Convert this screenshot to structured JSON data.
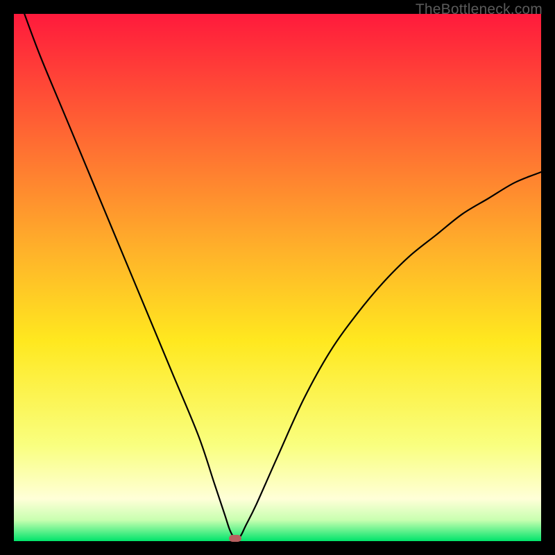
{
  "watermark": "TheBottleneck.com",
  "colors": {
    "top": "#ff1a3c",
    "upper_mid": "#ff7a2a",
    "mid": "#ffd21f",
    "lower_mid": "#f6ff72",
    "pale": "#ffffd8",
    "green": "#00e46b",
    "curve": "#000000",
    "marker": "#b86060",
    "frame": "#000000"
  },
  "chart_data": {
    "type": "line",
    "title": "",
    "xlabel": "",
    "ylabel": "",
    "xlim": [
      0,
      100
    ],
    "ylim": [
      0,
      100
    ],
    "x_min_position": 42,
    "note": "V-shaped bottleneck curve. Left branch descends steeply from top-left; right branch ascends asymptotically toward ~70% height at right edge. Minimum (near-zero) at x≈42.",
    "series": [
      {
        "name": "bottleneck-curve",
        "x": [
          2,
          5,
          10,
          15,
          20,
          25,
          30,
          35,
          38,
          40,
          41,
          42,
          43,
          44,
          46,
          50,
          55,
          60,
          65,
          70,
          75,
          80,
          85,
          90,
          95,
          100
        ],
        "values": [
          100,
          92,
          80,
          68,
          56,
          44,
          32,
          20,
          11,
          5,
          2,
          0.5,
          1,
          3,
          7,
          16,
          27,
          36,
          43,
          49,
          54,
          58,
          62,
          65,
          68,
          70
        ]
      }
    ],
    "background_gradient_stops": [
      {
        "pct": 0,
        "color": "#ff1a3c"
      },
      {
        "pct": 45,
        "color": "#ffb22a"
      },
      {
        "pct": 62,
        "color": "#ffe81f"
      },
      {
        "pct": 82,
        "color": "#f9ff80"
      },
      {
        "pct": 92,
        "color": "#ffffd8"
      },
      {
        "pct": 96,
        "color": "#c8ffb0"
      },
      {
        "pct": 100,
        "color": "#00e46b"
      }
    ]
  }
}
